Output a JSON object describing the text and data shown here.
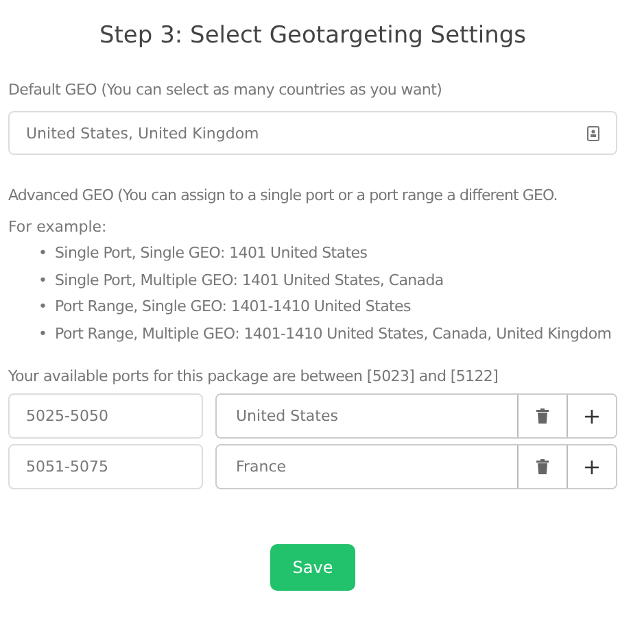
{
  "title": "Step 3: Select Geotargeting Settings",
  "default_geo": {
    "label": "Default GEO (You can select as many countries as you want)",
    "value": "United States, United Kingdom"
  },
  "advanced_geo": {
    "description": "Advanced GEO (You can assign to a single port or a port range a different GEO.",
    "example_label": "For example:",
    "examples": [
      {
        "bullet": "•",
        "text": "Single Port, Single GEO: 1401 United States"
      },
      {
        "bullet": "•",
        "text": "Single Port, Multiple GEO: 1401 United States, Canada"
      },
      {
        "bullet": "•",
        "text": "Port Range, Single GEO: 1401-1410 United States"
      },
      {
        "bullet": "•",
        "text": "Port Range, Multiple GEO: 1401-1410 United States, Canada, United Kingdom"
      }
    ]
  },
  "ports_label": "Your available ports for this package are between [5023] and [5122]",
  "rows": [
    {
      "ports": "5025-5050",
      "geo": "United States",
      "add": "+"
    },
    {
      "ports": "5051-5075",
      "geo": "France",
      "add": "+"
    }
  ],
  "save_button": "Save"
}
